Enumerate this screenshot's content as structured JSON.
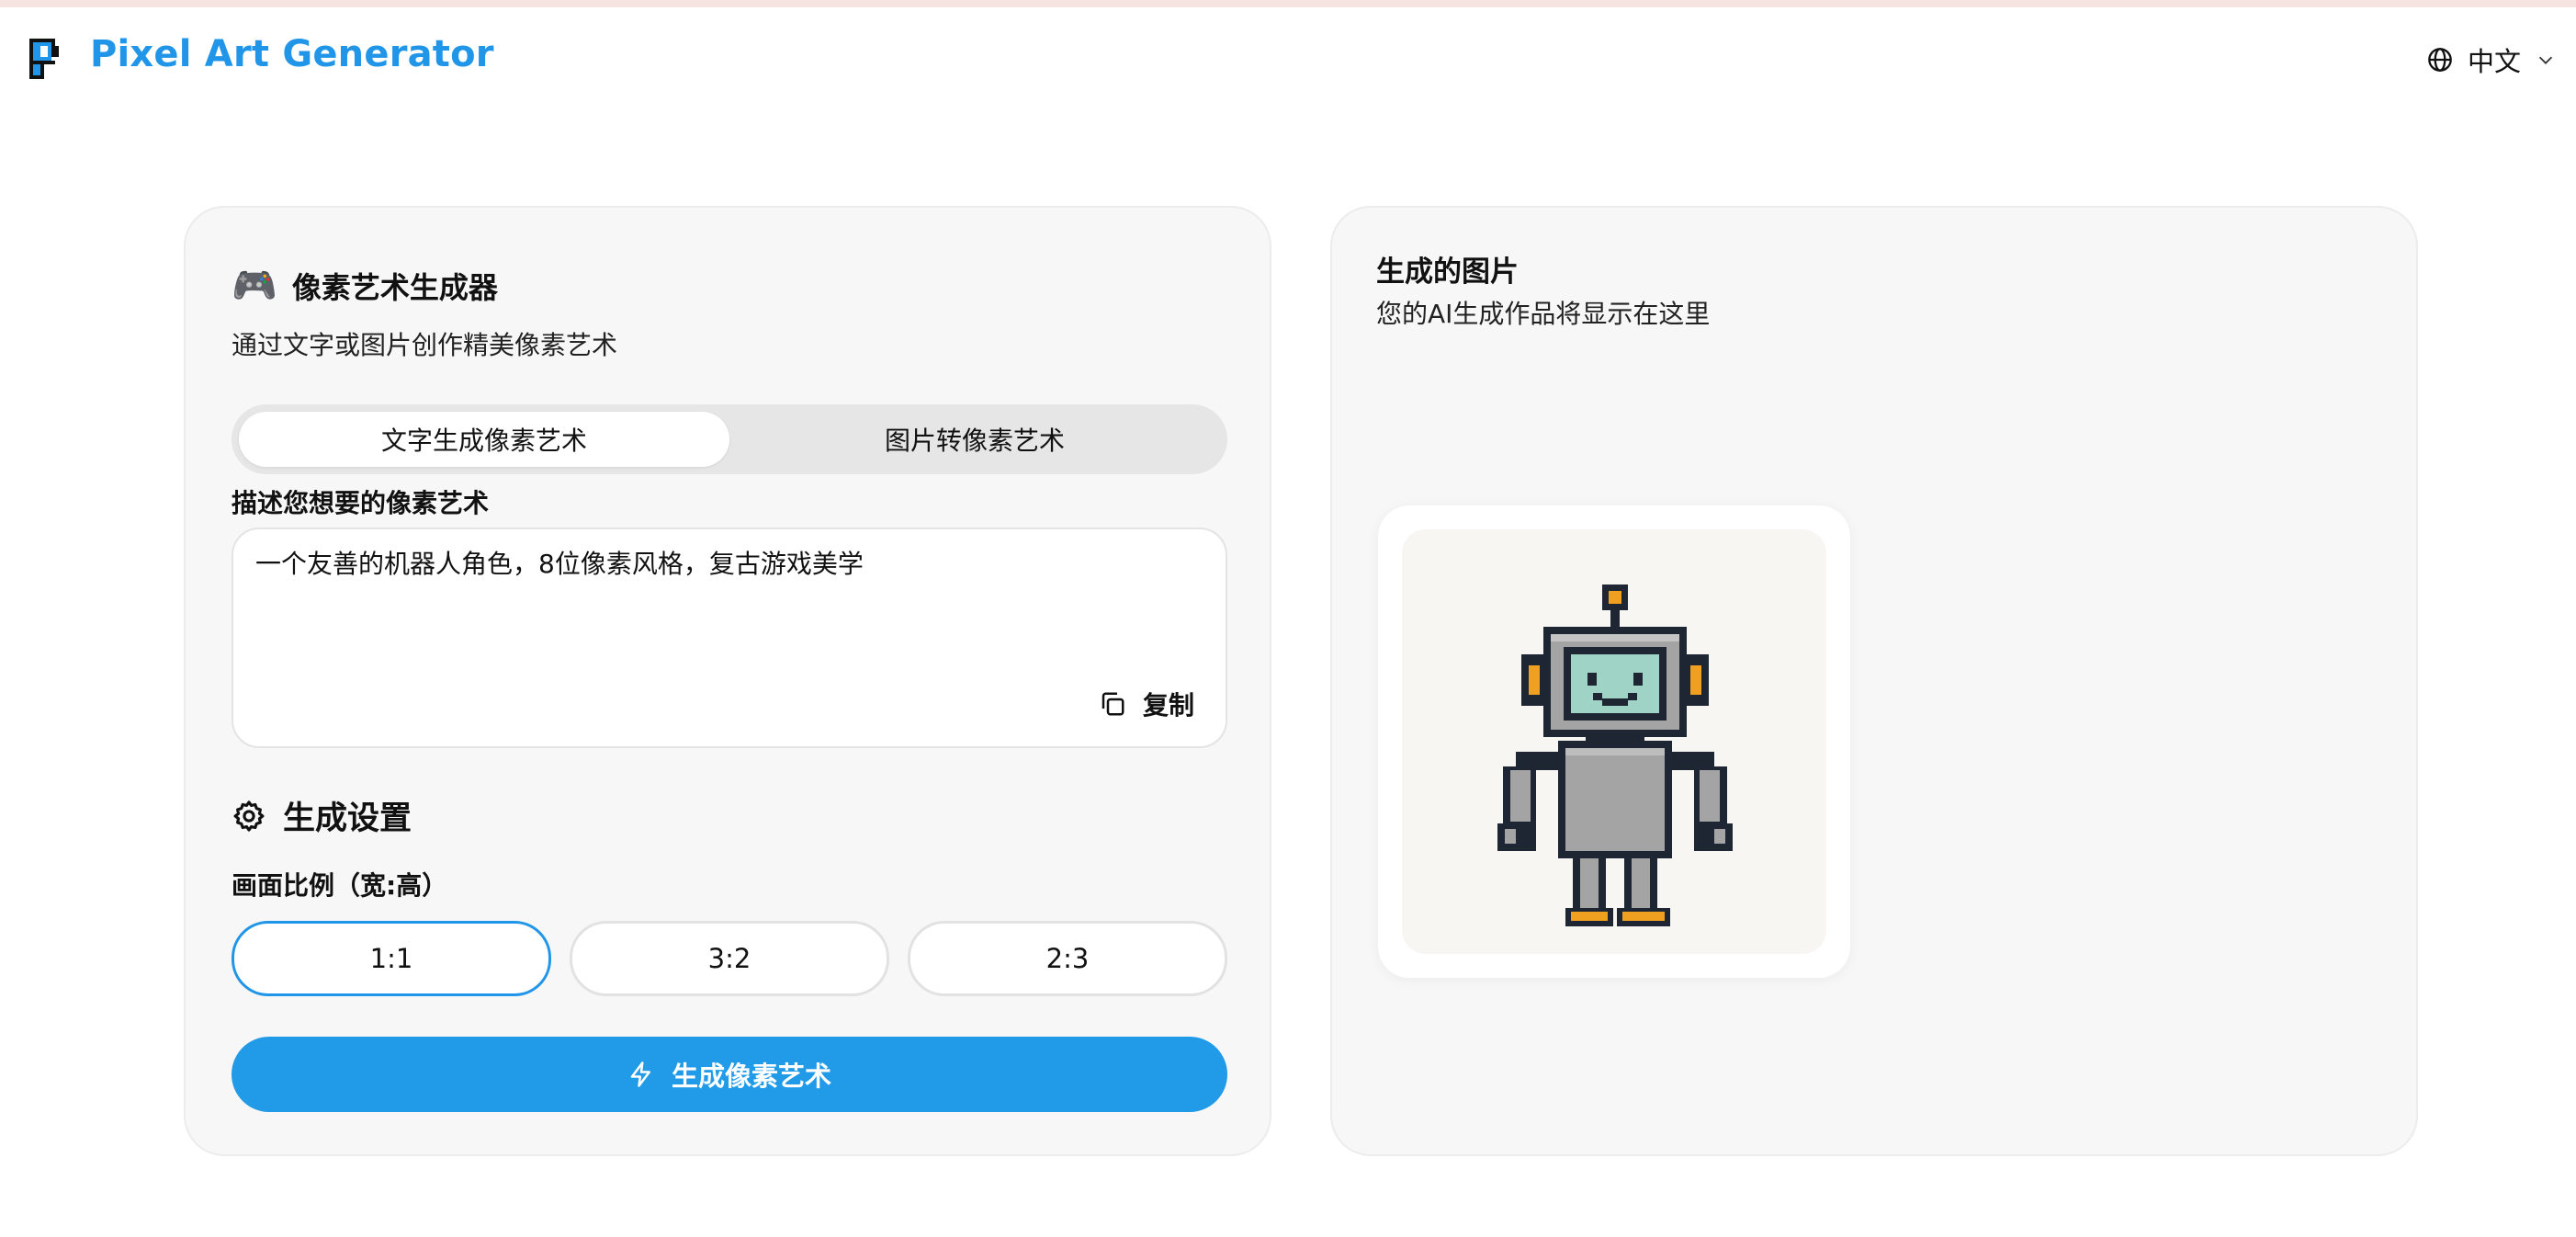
{
  "header": {
    "brand": "Pixel Art Generator",
    "logo_icon": "pixel-p-logo",
    "language": "中文",
    "language_icon": "globe-icon",
    "language_caret_icon": "chevron-down-icon"
  },
  "generator": {
    "title_emoji": "🎮",
    "title": "像素艺术生成器",
    "subtitle": "通过文字或图片创作精美像素艺术",
    "tabs": [
      {
        "label": "文字生成像素艺术",
        "active": true
      },
      {
        "label": "图片转像素艺术",
        "active": false
      }
    ],
    "prompt_label": "描述您想要的像素艺术",
    "prompt_value": "一个友善的机器人角色，8位像素风格，复古游戏美学",
    "copy_label": "复制",
    "copy_icon": "copy-icon",
    "settings_title": "生成设置",
    "settings_icon": "gear-icon",
    "ratio_label": "画面比例（宽:高）",
    "ratios": [
      {
        "label": "1:1",
        "selected": true
      },
      {
        "label": "3:2",
        "selected": false
      },
      {
        "label": "2:3",
        "selected": false
      }
    ],
    "generate_label": "生成像素艺术",
    "generate_icon": "lightning-icon"
  },
  "result": {
    "title": "生成的图片",
    "subtitle": "您的AI生成作品将显示在这里",
    "image_subject": "pixel-robot"
  },
  "colors": {
    "accent": "#2196e8",
    "button": "#219be8",
    "card_bg": "#f7f7f7",
    "robot_outline": "#1e2633",
    "robot_body": "#a4a4a4",
    "robot_screen": "#9ed3c5",
    "robot_orange": "#f0a020"
  }
}
